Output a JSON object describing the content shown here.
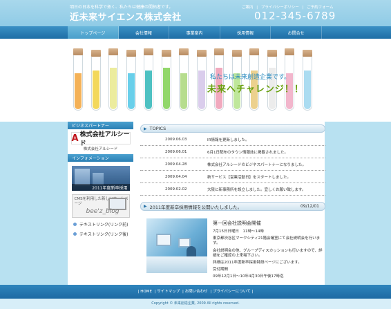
{
  "header": {
    "tagline": "明日の日本を科学で拓く、私たちは健康の開拓者です。",
    "logo": "近未来サイエンス株式会社",
    "toplinks": [
      "ご案内",
      "|",
      "プライバシーポリシー",
      "|",
      "ご予約フォーム"
    ],
    "phone": "012-345-6789"
  },
  "nav": [
    "トップページ",
    "会社情報",
    "事業案内",
    "採用情報",
    "お問合せ"
  ],
  "hero": {
    "line1": "私たちは未来創造企業です。",
    "line2": "未来へチャレンジ！！",
    "tube_colors": [
      "#f2a33a",
      "#f1d13e",
      "#e9e98d",
      "#4fc7e6",
      "#2fb6b7",
      "#7fd051",
      "#a9d77a",
      "#d4c4e9",
      "#ef9ab3",
      "#b4e38a",
      "#e9c97a",
      "#e9e9e9",
      "#f0a9c3",
      "#9cd6ef"
    ]
  },
  "sidebar": {
    "partner_heading": "ビジネスパートナー",
    "partner_logo_mark": "A",
    "partner_logo_text": "株式会社アルシード",
    "partner_caption": "株式会社アルシード",
    "info_heading": "インフォメーション",
    "banner1_text": "2011年度新卒採用",
    "banner2_text": "CMSを利用した新しいホームページ",
    "banner2_brand": "bee'z_blog",
    "links": [
      "テキストリンク(リンク前)",
      "テキストリンク(リンク後)"
    ]
  },
  "topics": {
    "heading": "TOPICS",
    "items": [
      {
        "date": "2009.06.03",
        "text": "IR情報を更新しました。"
      },
      {
        "date": "2009.06.01",
        "text": "6月1日配布のタウン情報誌に掲載されました。"
      },
      {
        "date": "2009.04.28",
        "text": "株式会社アルシードのビジネスパートナーになりました。"
      },
      {
        "date": "2009.04.04",
        "text": "新サービス【営業活動日】をスタートしました。"
      },
      {
        "date": "2009.02.02",
        "text": "大阪に新事務所を設立しました。宜しくお願い致します。"
      }
    ]
  },
  "recruit": {
    "headline": "2011年度新卒採用情報を公開いたしました。",
    "date": "09/12/01",
    "title": "第一回会社説明会開催",
    "body": [
      "7月15日日曜日　11時〜14時",
      "東京都渋谷区マークシティ21階会議室にて会社説明会を行います。",
      "会社説明会の他、グループディスカッションも行いますので、詳細をご確認の上来場下さい。",
      "詳細は2011年度新卒採用特設ページにございます。",
      "受付期間",
      "09年12月1日〜10年4月30日午後17時迄"
    ]
  },
  "footer": {
    "links": [
      "| HOME",
      "| サイトマップ",
      "| お問い合わせ",
      "| プライバシーについて |"
    ],
    "copyright": "Copyright © 未来創造企業, 2009 All rights reserved."
  }
}
